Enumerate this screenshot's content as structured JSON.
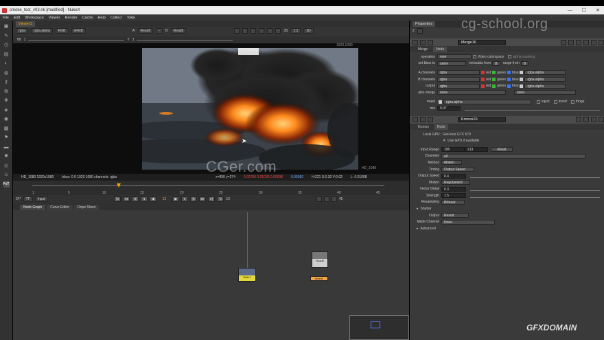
{
  "window": {
    "title": "smoke_test_v03.nk [modified] - NukeX"
  },
  "menu": [
    "File",
    "Edit",
    "Workspace",
    "Viewer",
    "Render",
    "Cache",
    "Help",
    "Collect",
    "TokE"
  ],
  "toolbar_icons": [
    "image-icon",
    "draw-icon",
    "time-icon",
    "channel-icon",
    "color-icon",
    "filter-icon",
    "keyer-icon",
    "merge-icon",
    "transform-icon",
    "3d-icon",
    "views-icon",
    "metadata-icon",
    "toolsets-icon",
    "other-icon",
    "particles-icon",
    "deep-icon",
    "furnace-icon",
    "fxt-icon"
  ],
  "viewer": {
    "tab": "Viewer1",
    "channels": "rgba",
    "alpha": "rgba.alpha",
    "colorspace": "RGB",
    "lut": "sRGB",
    "input_a_label": "A",
    "input_a": "Read5",
    "input_b": "-",
    "input_b_label": "B",
    "input_b_node": "Read5",
    "zoom": "35",
    "ratio": "1:1",
    "mode": "2D",
    "fstop": "f/8",
    "fstop_value": "1",
    "y_label": "Y",
    "y_value": "1",
    "format_label": "1920,1080",
    "hd_label": "HD_1080",
    "info": {
      "format": "HD_1080 1920x1080",
      "bbox": "bbox: 0 0 1920 1080 channels: rgba",
      "coords": "x=890 y=274",
      "rgb": "0.00796 0.01036 0.00698",
      "value": "0.00580",
      "hsv": "H:221 S:0.30 V:0.02",
      "l": "L: 0.01008"
    }
  },
  "timeline": {
    "ticks": [
      "1",
      "5",
      "10",
      "15",
      "20",
      "25",
      "30",
      "35",
      "40",
      "45"
    ],
    "current": "12",
    "end": "45",
    "fps": "24*",
    "tf": "TF",
    "range": "Input",
    "step": "10"
  },
  "nodegraph": {
    "tabs": [
      "Node Graph",
      "Curve Editor",
      "Dope Sheet"
    ],
    "nodes": [
      {
        "name": "Write1"
      },
      {
        "name": "Read5"
      },
      {
        "name": "Invert1"
      }
    ]
  },
  "properties": {
    "title": "Properties",
    "counter": "2",
    "merge": {
      "name": "Merge16",
      "tabs": [
        "Merge",
        "Node"
      ],
      "operation_label": "operation",
      "operation": "over",
      "video_colorspace": "Video colorspace",
      "alpha_masking": "alpha masking",
      "bbox_label": "set bbox to",
      "bbox": "union",
      "metadata_label": "metadata from",
      "metadata": "B",
      "range_label": "range from",
      "range": "B",
      "a_channels_label": "A channels",
      "a_channels": "rgba",
      "b_channels_label": "B channels",
      "b_channels": "rgba",
      "output_label": "output",
      "output": "rgba",
      "also_merge_label": "also merge",
      "also_merge": "none",
      "also_merge_b": "none",
      "red": "red",
      "green": "green",
      "blue": "blue",
      "alpha_a": "rgba.alpha",
      "alpha_b": "rgba.alpha",
      "alpha_out": "rgba.alpha",
      "mask_label": "mask",
      "mask": "rgba.alpha",
      "inject": "inject",
      "invert": "invert",
      "fringe": "fringe",
      "mix_label": "mix",
      "mix": "0.07"
    },
    "kronos": {
      "name": "Kronos10",
      "tabs": [
        "Kronos",
        "Node"
      ],
      "gpu_label": "Local GPU:",
      "gpu": "GeForce GTX 670",
      "use_gpu": "Use GPU if available",
      "input_range_label": "Input Range",
      "input_range_start": "195",
      "input_range_end": "213",
      "reset": "Reset",
      "channels_label": "Channels",
      "channels": "all",
      "method_label": "Method",
      "method": "Motion",
      "timing_label": "Timing",
      "timing": "Output Speed",
      "output_speed_label": "Output Speed",
      "output_speed": "0.4",
      "motion_label": "Motion",
      "motion": "Regularized",
      "vector_detail_label": "Vector Detail",
      "vector_detail": "0.3",
      "strength_label": "Strength",
      "strength": "1.5",
      "resampling_label": "Resampling",
      "resampling": "Bilinear",
      "shutter": "Shutter",
      "output_label": "Output",
      "output": "Result",
      "matte_label": "Matte Channel",
      "matte": "None",
      "advanced": "Advanced"
    }
  },
  "watermarks": {
    "top": "cg-school.org",
    "center": "CGer.com",
    "bottom": "GFXDOMAIN"
  },
  "colors": {
    "accent": "#f0a400",
    "panel": "#3a3a3a"
  }
}
